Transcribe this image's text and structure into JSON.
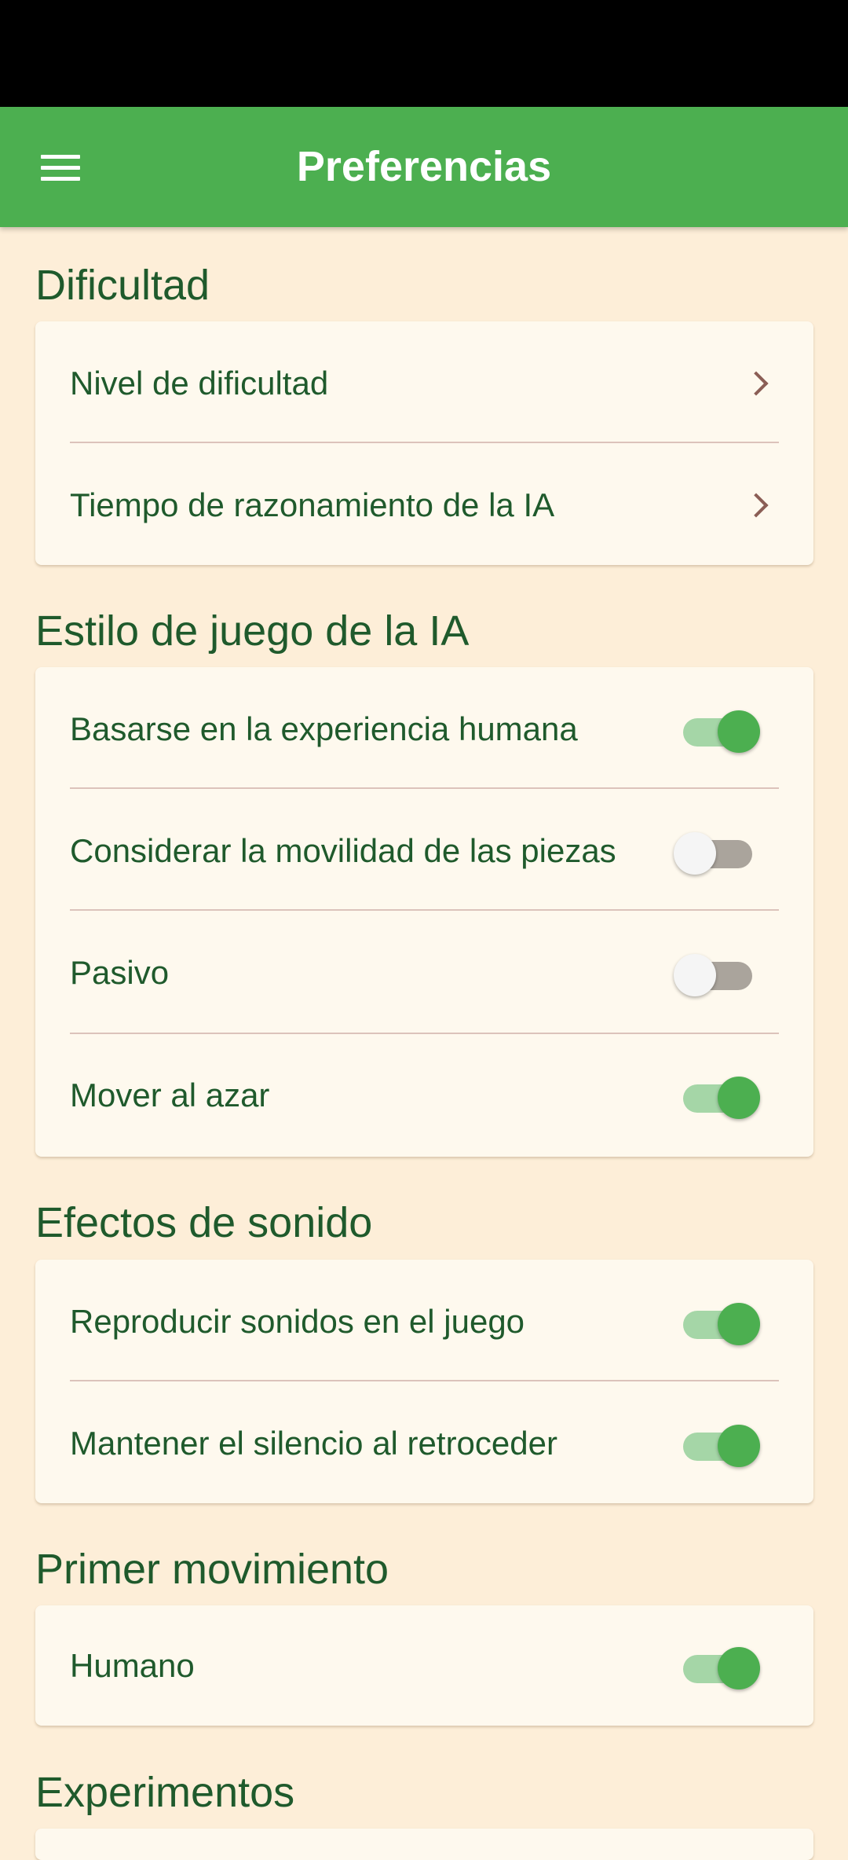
{
  "app_bar": {
    "title": "Preferencias"
  },
  "sections": {
    "dificultad": {
      "title": "Dificultad",
      "items": [
        {
          "label": "Nivel de dificultad"
        },
        {
          "label": "Tiempo de razonamiento de la IA"
        }
      ]
    },
    "estilo": {
      "title": "Estilo de juego de la IA",
      "items": [
        {
          "label": "Basarse en la experiencia humana",
          "checked": true
        },
        {
          "label": "Considerar la movilidad de las piezas",
          "checked": false
        },
        {
          "label": "Pasivo",
          "checked": false
        },
        {
          "label": "Mover al azar",
          "checked": true
        }
      ]
    },
    "sonido": {
      "title": "Efectos de sonido",
      "items": [
        {
          "label": "Reproducir sonidos en el juego",
          "checked": true
        },
        {
          "label": "Mantener el silencio al retroceder",
          "checked": true
        }
      ]
    },
    "primer": {
      "title": "Primer movimiento",
      "items": [
        {
          "label": "Humano",
          "checked": true
        }
      ]
    },
    "experimentos": {
      "title": "Experimentos"
    }
  },
  "colors": {
    "primary": "#4caf50",
    "background": "#fdeed8",
    "card": "#fef9ee",
    "text": "#1f5a2c"
  }
}
